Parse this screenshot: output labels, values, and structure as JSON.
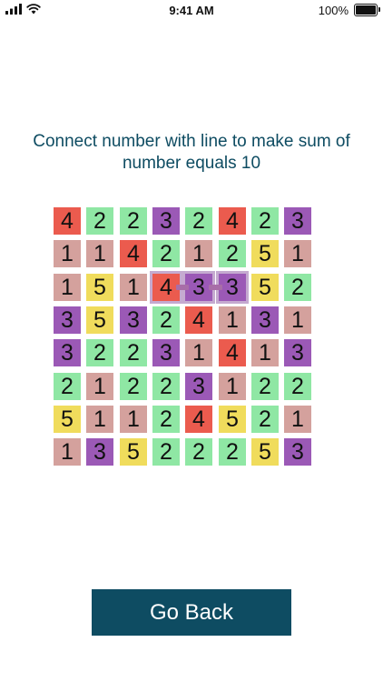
{
  "status_bar": {
    "time": "9:41 AM",
    "battery_percent": "100%",
    "icons": [
      "signal-bars-icon",
      "wifi-icon",
      "battery-icon"
    ]
  },
  "instruction": "Connect number with line to make sum of number equals 10",
  "grid": {
    "rows": [
      [
        4,
        2,
        2,
        3,
        2,
        4,
        2,
        3
      ],
      [
        1,
        1,
        4,
        2,
        1,
        2,
        5,
        1
      ],
      [
        1,
        5,
        1,
        4,
        3,
        3,
        5,
        2
      ],
      [
        3,
        5,
        3,
        2,
        4,
        1,
        3,
        1
      ],
      [
        3,
        2,
        2,
        3,
        1,
        4,
        1,
        3
      ],
      [
        2,
        1,
        2,
        2,
        3,
        1,
        2,
        2
      ],
      [
        5,
        1,
        1,
        2,
        4,
        5,
        2,
        1
      ],
      [
        1,
        3,
        5,
        2,
        2,
        2,
        5,
        3
      ]
    ],
    "selected_cells": [
      [
        2,
        3
      ],
      [
        2,
        4
      ],
      [
        2,
        5
      ]
    ],
    "selected_sum": 10
  },
  "colors": {
    "1": "#d4a19d",
    "2": "#8fe7a4",
    "3": "#9b59b6",
    "4": "#eb5b4e",
    "5": "#f0dc5c",
    "accent": "#0e4c62",
    "selection_line": "#a86ea8"
  },
  "go_back_label": "Go Back"
}
